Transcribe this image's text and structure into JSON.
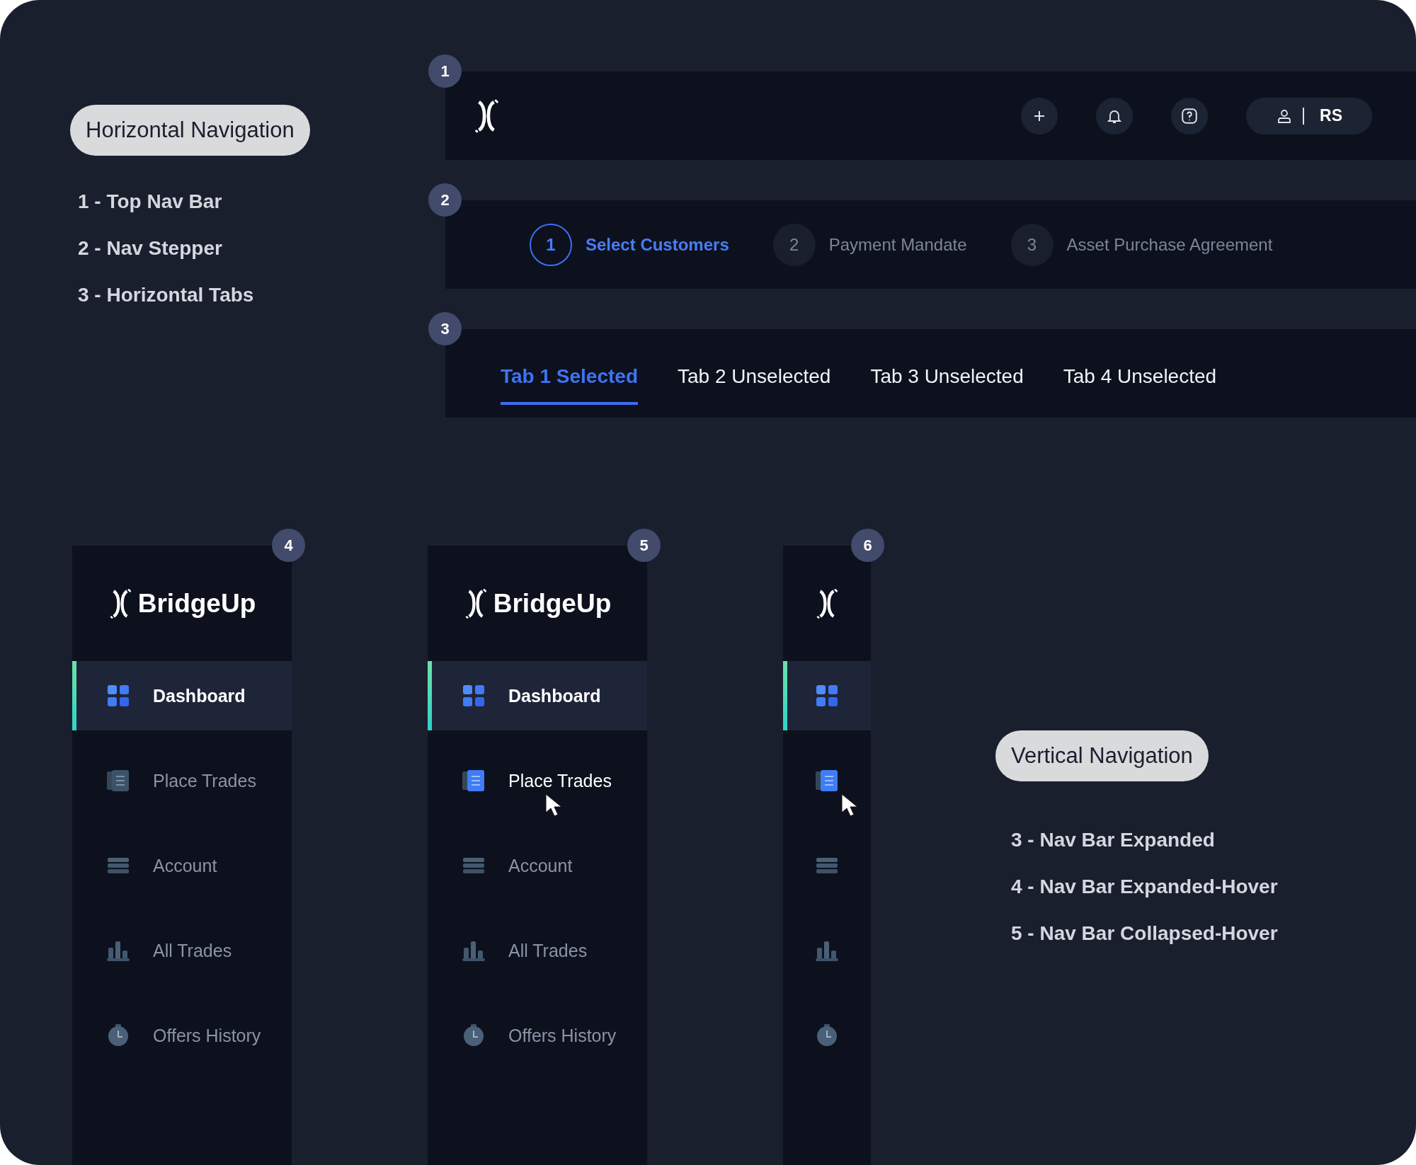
{
  "horizontal_nav": {
    "title": "Horizontal Navigation",
    "legend": [
      "1 - Top Nav Bar",
      "2 - Nav Stepper",
      "3 - Horizontal Tabs"
    ]
  },
  "top_nav_bar": {
    "badge": "1",
    "actions": [
      {
        "kind": "plus"
      },
      {
        "kind": "bell"
      },
      {
        "kind": "help"
      }
    ],
    "user_initials": "RS"
  },
  "nav_stepper": {
    "badge": "2",
    "steps": [
      {
        "number": "1",
        "label": "Select Customers",
        "selected": true
      },
      {
        "number": "2",
        "label": "Payment Mandate",
        "selected": false
      },
      {
        "number": "3",
        "label": "Asset Purchase Agreement",
        "selected": false
      }
    ]
  },
  "horizontal_tabs": {
    "badge": "3",
    "tabs": [
      {
        "label": "Tab 1 Selected",
        "selected": true
      },
      {
        "label": "Tab 2 Unselected",
        "selected": false
      },
      {
        "label": "Tab 3 Unselected",
        "selected": false
      },
      {
        "label": "Tab 4 Unselected",
        "selected": false
      }
    ]
  },
  "sidebars": [
    {
      "badge": "4",
      "brand": "BridgeUp",
      "items": [
        {
          "kind": "grid",
          "label": "Dashboard",
          "selected": true,
          "hovered": false
        },
        {
          "kind": "document",
          "label": "Place Trades",
          "selected": false,
          "hovered": false
        },
        {
          "kind": "stack",
          "label": "Account",
          "selected": false,
          "hovered": false
        },
        {
          "kind": "bars",
          "label": "All Trades",
          "selected": false,
          "hovered": false
        },
        {
          "kind": "clock",
          "label": "Offers History",
          "selected": false,
          "hovered": false
        }
      ]
    },
    {
      "badge": "5",
      "brand": "BridgeUp",
      "items": [
        {
          "kind": "grid",
          "label": "Dashboard",
          "selected": true,
          "hovered": false
        },
        {
          "kind": "document",
          "label": "Place Trades",
          "selected": false,
          "hovered": true
        },
        {
          "kind": "stack",
          "label": "Account",
          "selected": false,
          "hovered": false
        },
        {
          "kind": "bars",
          "label": "All Trades",
          "selected": false,
          "hovered": false
        },
        {
          "kind": "clock",
          "label": "Offers History",
          "selected": false,
          "hovered": false
        }
      ]
    },
    {
      "badge": "6",
      "items": [
        {
          "kind": "grid",
          "selected": true,
          "hovered": false
        },
        {
          "kind": "document",
          "selected": false,
          "hovered": true
        },
        {
          "kind": "stack",
          "selected": false,
          "hovered": false
        },
        {
          "kind": "bars",
          "selected": false,
          "hovered": false
        },
        {
          "kind": "clock",
          "selected": false,
          "hovered": false
        }
      ]
    }
  ],
  "vertical_nav": {
    "title": "Vertical Navigation",
    "legend": [
      "3 - Nav Bar Expanded",
      "4 - Nav Bar Expanded-Hover",
      "5 - Nav Bar Collapsed-Hover"
    ]
  }
}
